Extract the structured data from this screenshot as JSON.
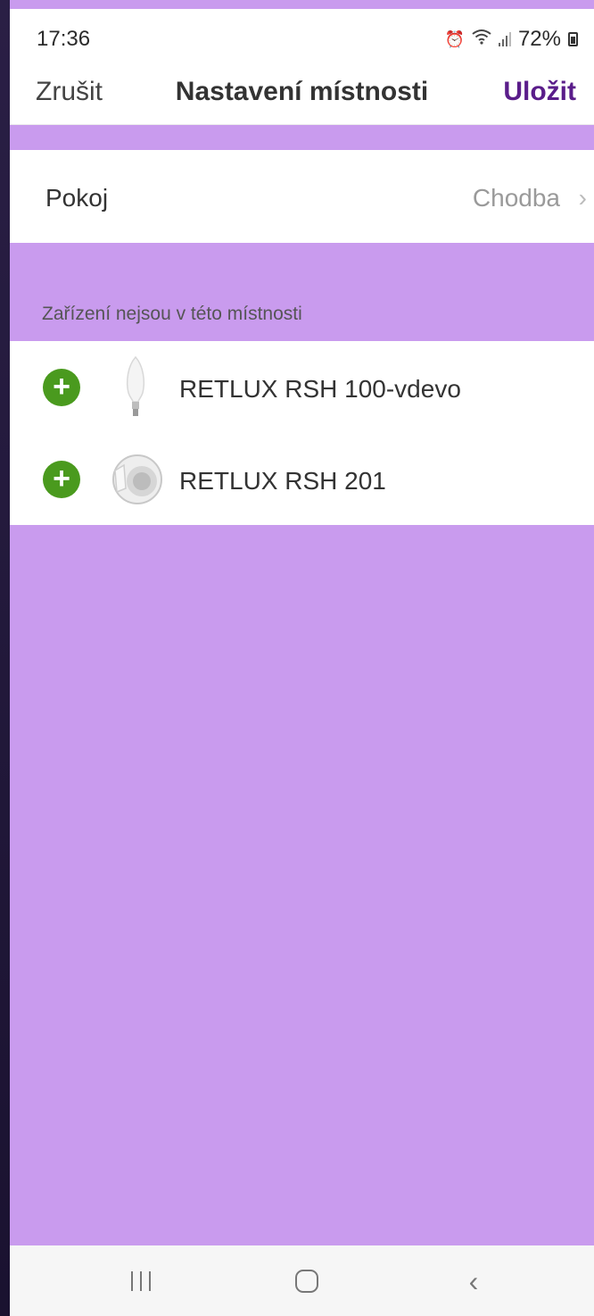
{
  "status_bar": {
    "time": "17:36",
    "battery": "72%",
    "icons": [
      "alarm-icon",
      "wifi-icon",
      "signal-icon",
      "battery-icon"
    ]
  },
  "header": {
    "cancel_label": "Zrušit",
    "title": "Nastavení místnosti",
    "save_label": "Uložit"
  },
  "room": {
    "label": "Pokoj",
    "value": "Chodba"
  },
  "devices_section": {
    "header": "Zařízení nejsou v této místnosti",
    "items": [
      {
        "name": "RETLUX RSH 100-vdevo",
        "icon": "bulb-icon"
      },
      {
        "name": "RETLUX RSH 201",
        "icon": "smart-plug-icon"
      }
    ]
  },
  "nav_bar": {
    "buttons": [
      "recent-apps-icon",
      "home-icon",
      "back-icon"
    ]
  },
  "colors": {
    "background_purple": "#c99bee",
    "accent": "#5a1d8a",
    "add_button": "#4a9a1e"
  }
}
